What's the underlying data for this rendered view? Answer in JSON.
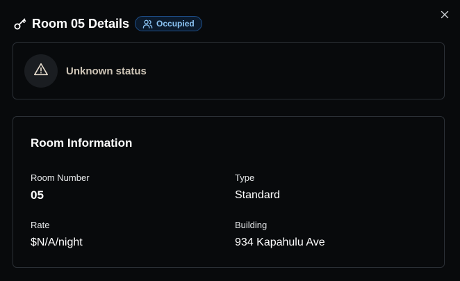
{
  "header": {
    "title": "Room 05 Details",
    "badge": "Occupied",
    "icons": {
      "title_icon": "key-icon",
      "badge_icon": "users-icon",
      "close_icon": "close-icon"
    }
  },
  "status": {
    "text": "Unknown status",
    "icon": "warning-triangle-icon"
  },
  "room_info": {
    "title": "Room Information",
    "fields": {
      "room_number": {
        "label": "Room Number",
        "value": "05"
      },
      "type": {
        "label": "Type",
        "value": "Standard"
      },
      "rate": {
        "label": "Rate",
        "value": "$N/A/night"
      },
      "building": {
        "label": "Building",
        "value": "934 Kapahulu Ave"
      }
    }
  },
  "colors": {
    "background": "#080a0c",
    "border": "#2b3036",
    "badge_border": "#1e4f8a",
    "badge_text": "#8cc5f5",
    "status_text": "#cfc6b8"
  }
}
